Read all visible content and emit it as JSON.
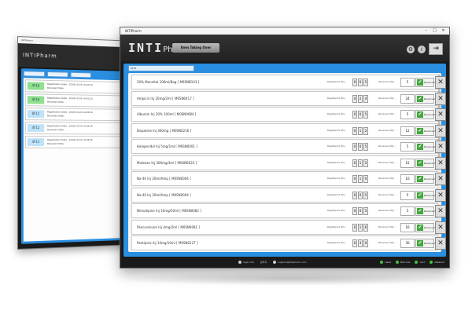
{
  "back_window": {
    "title": "INTIPharm",
    "brand_main": "INTI",
    "brand_sub": "Pharm",
    "filters": [
      "",
      "",
      "",
      ""
    ],
    "rows": [
      {
        "tag": "4F16",
        "color": "#8fe08f",
        "line1": "Registration Date : 2018-10-24 14:42:23",
        "line2": "Received Date :"
      },
      {
        "tag": "4F16",
        "color": "#8fe08f",
        "line1": "Registration Date : 2018-10-24 14:42:23",
        "line2": "Received Date :"
      },
      {
        "tag": "8F12",
        "color": "#bfe3f7",
        "line1": "Registration Date : 2018-10-24 14:28:29",
        "line2": "Received Date :"
      },
      {
        "tag": "4F12",
        "color": "#bfe3f7",
        "line1": "Registration Date : 2018-10-24 14:28:29",
        "line2": "Received Date :"
      },
      {
        "tag": "4F12",
        "color": "#bfe3f7",
        "line1": "Registration Date : 2018-10-24 14:28:29",
        "line2": "Received Date :"
      }
    ]
  },
  "front_window": {
    "title": "INTIPharm",
    "brand_main": "INTI",
    "brand_sub": "Pharm",
    "takeover_label": "Item Taking Over",
    "rfid_label": "RFID",
    "registered_label": "Registered Qty :",
    "received_label": "Received Qty :",
    "received_button_label": "Received",
    "cancel_label": "Cancel",
    "items": [
      {
        "name": "20% Mannitol 100ml/Bag   [   M0SNB103   ]",
        "digits": [
          "0",
          "0",
          "5"
        ],
        "received": "5"
      },
      {
        "name": "Ampicin Inj 20mg/2ml   [   M0SN0417   ]",
        "digits": [
          "0",
          "2",
          "4"
        ],
        "received": "24"
      },
      {
        "name": "Albumin Inj 20% 100ml   [   M0SN0084   ]",
        "digits": [
          "0",
          "0",
          "5"
        ],
        "received": "5"
      },
      {
        "name": "Depakine Inj 400mg   [   M0SN0216   ]",
        "digits": [
          "0",
          "1",
          "2"
        ],
        "received": "12"
      },
      {
        "name": "Haloperidol Inj 5mg/1ml   [   M0SN0001   ]",
        "digits": [
          "0",
          "0",
          "5"
        ],
        "received": "5"
      },
      {
        "name": "Mutesan Inj 300mg/3ml   [   M0SN0633   ]",
        "digits": [
          "0",
          "1",
          "5"
        ],
        "received": "15"
      },
      {
        "name": "Na-40 Inj 20ml/Amp   [   M0SN0004   ]",
        "digits": [
          "0",
          "1",
          "0"
        ],
        "received": "10"
      },
      {
        "name": "Na-40 Inj 20ml/Amp   [   M0SN0004   ]",
        "digits": [
          "0",
          "0",
          "5"
        ],
        "received": "5"
      },
      {
        "name": "Nimodipine Inj 10mg/50ml   [   M0SN0082   ]",
        "digits": [
          "0",
          "0",
          "5"
        ],
        "received": "5"
      },
      {
        "name": "Pancuronium Inj 4mg/2ml   [   M0SN0081   ]",
        "digits": [
          "0",
          "1",
          "6"
        ],
        "received": "16"
      },
      {
        "name": "Pantipine Inj 10mg/10ml   [   M0SN0127   ]",
        "digits": [
          "0",
          "3",
          "0"
        ],
        "received": "30"
      }
    ],
    "status": {
      "login_label": "login info",
      "user": "관리자",
      "support": "support@intipharm.com",
      "right": [
        "Label",
        "Barcode",
        "Card",
        "Network"
      ]
    }
  }
}
